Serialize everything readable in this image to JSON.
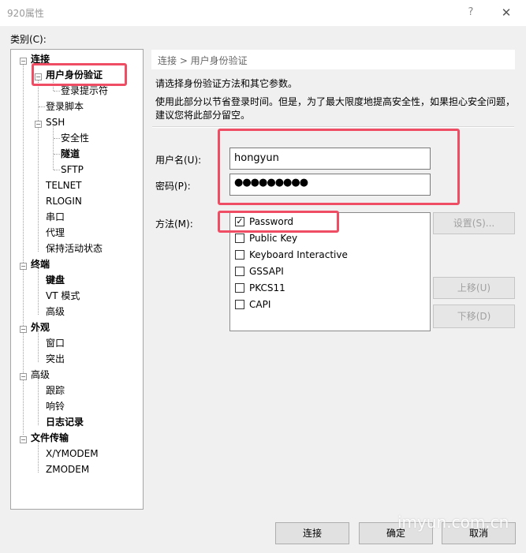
{
  "window": {
    "title": "920属性",
    "help": "?",
    "close": "✕"
  },
  "category_label": "类别(C):",
  "tree": {
    "items": [
      {
        "label": "连接",
        "bold": true
      },
      {
        "label": "用户身份验证",
        "bold": true
      },
      {
        "label": "登录提示符",
        "bold": false
      },
      {
        "label": "登录脚本",
        "bold": false
      },
      {
        "label": "SSH",
        "bold": false
      },
      {
        "label": "安全性",
        "bold": false
      },
      {
        "label": "隧道",
        "bold": true
      },
      {
        "label": "SFTP",
        "bold": false
      },
      {
        "label": "TELNET",
        "bold": false
      },
      {
        "label": "RLOGIN",
        "bold": false
      },
      {
        "label": "串口",
        "bold": false
      },
      {
        "label": "代理",
        "bold": false
      },
      {
        "label": "保持活动状态",
        "bold": false
      },
      {
        "label": "终端",
        "bold": true
      },
      {
        "label": "键盘",
        "bold": true
      },
      {
        "label": "VT 模式",
        "bold": false
      },
      {
        "label": "高级",
        "bold": false
      },
      {
        "label": "外观",
        "bold": true
      },
      {
        "label": "窗口",
        "bold": false
      },
      {
        "label": "突出",
        "bold": false
      },
      {
        "label": "高级",
        "bold": false
      },
      {
        "label": "跟踪",
        "bold": false
      },
      {
        "label": "响铃",
        "bold": false
      },
      {
        "label": "日志记录",
        "bold": true
      },
      {
        "label": "文件传输",
        "bold": true
      },
      {
        "label": "X/YMODEM",
        "bold": false
      },
      {
        "label": "ZMODEM",
        "bold": false
      }
    ],
    "toggle_symbol": "−"
  },
  "panel": {
    "breadcrumb": "连接 > 用户身份验证",
    "description1": "请选择身份验证方法和其它参数。",
    "description2": "使用此部分以节省登录时间。但是，为了最大限度地提高安全性，如果担心安全问题，建议您将此部分留空。",
    "username_label": "用户名(U):",
    "username_value": "hongyun",
    "password_label": "密码(P):",
    "password_value": "●●●●●●●●●",
    "method_label": "方法(M):",
    "methods": [
      {
        "label": "Password",
        "checked": true,
        "mark": "✓"
      },
      {
        "label": "Public Key",
        "checked": false,
        "mark": ""
      },
      {
        "label": "Keyboard Interactive",
        "checked": false,
        "mark": ""
      },
      {
        "label": "GSSAPI",
        "checked": false,
        "mark": ""
      },
      {
        "label": "PKCS11",
        "checked": false,
        "mark": ""
      },
      {
        "label": "CAPI",
        "checked": false,
        "mark": ""
      }
    ],
    "settings_button": "设置(S)...",
    "move_up_button": "上移(U)",
    "move_down_button": "下移(D)"
  },
  "footer": {
    "connect_button": "连接",
    "ok_button": "确定",
    "cancel_button": "取消"
  },
  "watermark": "imyun.com.cn",
  "colors": {
    "highlight": "#ef4d63",
    "background": "#f0f0f0"
  }
}
